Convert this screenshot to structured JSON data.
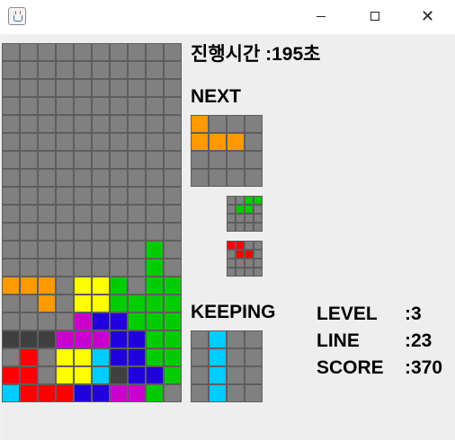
{
  "window": {
    "app_icon": "java-cup-icon",
    "controls": [
      "minimize-icon",
      "maximize-icon",
      "close-icon"
    ]
  },
  "colors": {
    "empty": "#808080",
    "grid_line": "#5e5e5e",
    "O": "#ffff00",
    "T": "#cc00cc",
    "L": "#ff9900",
    "J": "#2200dd",
    "I": "#00ccff",
    "S": "#00cc00",
    "Z": "#ff0000",
    "G": "#404040"
  },
  "game": {
    "time_label": "진행시간 :195초",
    "next_label": "NEXT",
    "keeping_label": "KEEPING",
    "stats": [
      {
        "name": "LEVEL",
        "value": ":3"
      },
      {
        "name": "LINE",
        "value": ":23"
      },
      {
        "name": "SCORE",
        "value": ":370"
      }
    ]
  },
  "board": {
    "cols": 10,
    "rows": 20,
    "rows_data": [
      "..........",
      "..........",
      "..........",
      "..........",
      "..........",
      "..........",
      "..........",
      "..........",
      "..........",
      "..........",
      "..........",
      "..........",
      "........S.",
      "........S.",
      "LLL.OOS.SS",
      "..L.OOSSSS",
      "....TJJSSS",
      "GGGTTTJJSS",
      ".Z.OOIJJSS",
      "ZZ.OOIGJJS",
      "IZZZJJTTS."
    ]
  },
  "next_main": {
    "cols": 4,
    "rows": 4,
    "rows_data": [
      "L...",
      "LLL.",
      "....",
      "...."
    ]
  },
  "next_small_1": {
    "cols": 4,
    "rows": 4,
    "rows_data": [
      "..SS",
      ".SS.",
      "....",
      "...."
    ]
  },
  "next_small_2": {
    "cols": 4,
    "rows": 4,
    "rows_data": [
      "ZZ..",
      ".ZZ.",
      "....",
      "...."
    ]
  },
  "keeping": {
    "cols": 4,
    "rows": 4,
    "rows_data": [
      ".I..",
      ".I..",
      ".I..",
      ".I.."
    ]
  }
}
